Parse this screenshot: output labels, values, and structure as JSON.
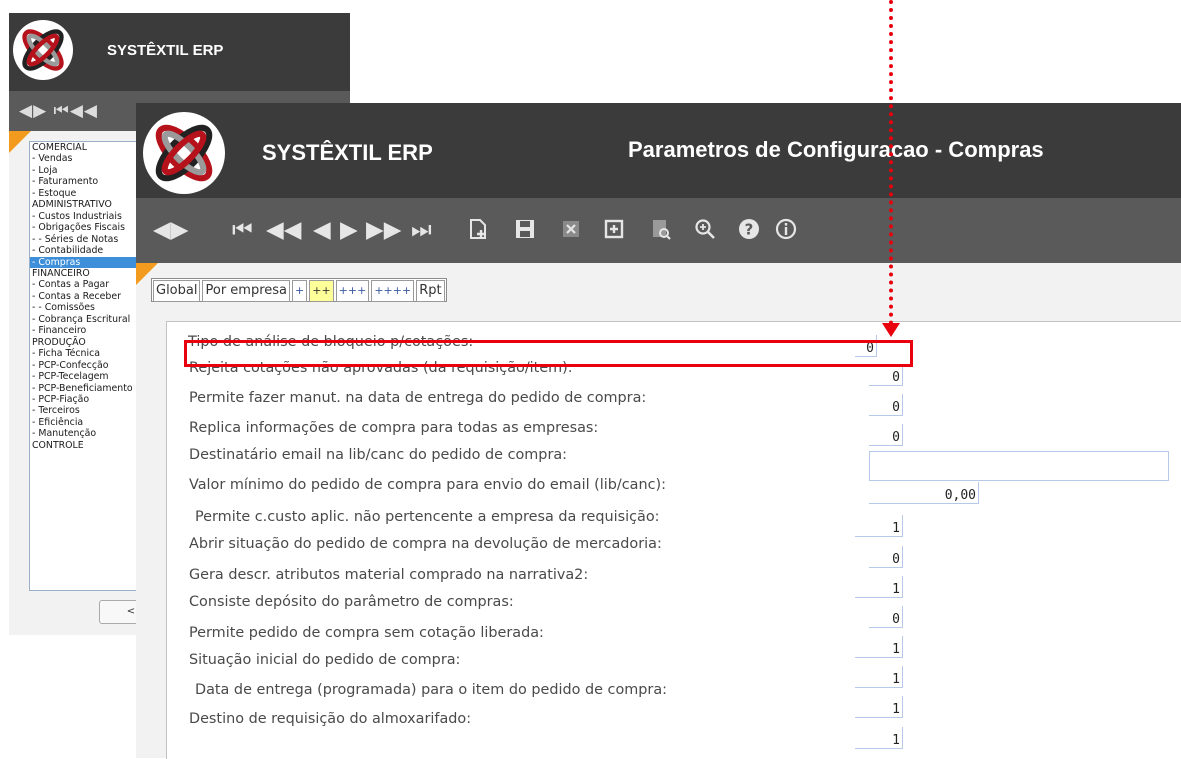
{
  "app": {
    "name": "SYSTÊXTIL ERP"
  },
  "page": {
    "title": "Parametros de Configuracao - Compras"
  },
  "back_window": {
    "menu": [
      "COMERCIAL",
      "- Vendas",
      "- Loja",
      "- Faturamento",
      "- Estoque",
      "ADMINISTRATIVO",
      "- Custos Industriais",
      "- Obrigações Fiscais",
      "- - Séries de Notas",
      "- Contabilidade",
      "- Compras",
      "FINANCEIRO",
      "- Contas a Pagar",
      "- Contas a Receber",
      "- - Comissões",
      "- Cobrança Escritural",
      "- Financeiro",
      "PRODUÇÃO",
      "- Ficha Técnica",
      "- PCP-Confecção",
      "- PCP-Tecelagem",
      "- PCP-Beneficiamento",
      "- PCP-Fiação",
      "- Terceiros",
      "- Eficiência",
      "- Manutenção",
      "CONTROLE"
    ],
    "active_item": "- Compras",
    "button_label": "<"
  },
  "toolbar": {
    "icons": [
      "nav-left-right-icon",
      "first-record-icon",
      "fast-rewind-icon",
      "prev-record-icon",
      "next-record-icon",
      "fast-forward-icon",
      "last-record-icon",
      "new-record-icon",
      "save-icon",
      "delete-icon",
      "add-icon",
      "search-doc-icon",
      "zoom-in-icon",
      "help-icon",
      "info-icon"
    ]
  },
  "tabs": [
    {
      "label": "Global",
      "active": false
    },
    {
      "label": "Por empresa",
      "active": false
    },
    {
      "label": "+",
      "active": false
    },
    {
      "label": "++",
      "active": true
    },
    {
      "label": "+++",
      "active": false
    },
    {
      "label": "++++",
      "active": false
    },
    {
      "label": "Rpt",
      "active": false
    }
  ],
  "params": [
    {
      "label": "Tipo de análise de bloqueio p/cotações:",
      "value": "0"
    },
    {
      "label": "Rejeita cotações não aprovadas (da requisição/item):",
      "value": "0"
    },
    {
      "label": "Permite fazer manut. na data de entrega do pedido de compra:",
      "value": "0"
    },
    {
      "label": "Replica informações de compra para todas as empresas:",
      "value": "0"
    },
    {
      "label": "Destinatário email na lib/canc do pedido de compra:",
      "value": ""
    },
    {
      "label": "Valor mínimo do pedido de compra para envio do email (lib/canc):",
      "value": "0,00"
    },
    {
      "label": "Permite c.custo aplic. não pertencente a empresa da requisição:",
      "value": "1"
    },
    {
      "label": "Abrir situação do pedido de compra na devolução de mercadoria:",
      "value": "0"
    },
    {
      "label": "Gera descr. atributos material comprado na narrativa2:",
      "value": "1"
    },
    {
      "label": "Consiste depósito do parâmetro de compras:",
      "value": "0"
    },
    {
      "label": "Permite pedido de compra sem cotação liberada:",
      "value": "1"
    },
    {
      "label": "Situação inicial do pedido de compra:",
      "value": "1"
    },
    {
      "label": "Data de entrega (programada) para o item do pedido de compra:",
      "value": "1"
    },
    {
      "label": "Destino de requisição do almoxarifado:",
      "value": "1"
    }
  ],
  "colors": {
    "header": "#3b3b3b",
    "toolbar": "#5a5a5a",
    "accent": "#f29b1f",
    "highlight": "#e8000e",
    "active_menu": "#3d8fd9"
  }
}
